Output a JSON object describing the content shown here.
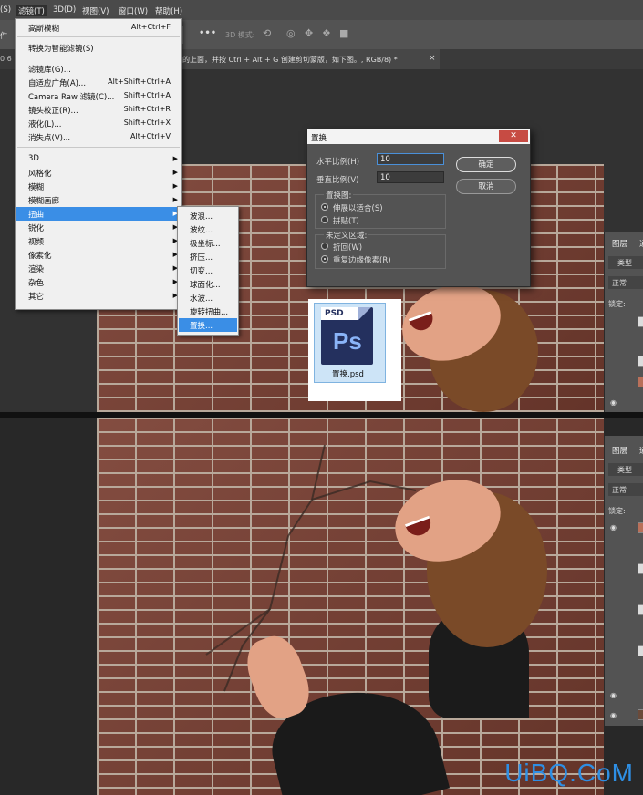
{
  "menubar": {
    "items": [
      "(S)",
      "滤镜(T)",
      "3D(D)",
      "视图(V)",
      "窗口(W)",
      "帮助(H)"
    ]
  },
  "optionsbar": {
    "left_label": "件",
    "more": "•••",
    "mode_label": "3D 模式:"
  },
  "doc_tab": {
    "text": "的上面，并按 Ctrl + Alt + G 创建剪切蒙版，如下图。, RGB/8) *",
    "close": "×",
    "left_fragment": "0 6"
  },
  "filter_menu": {
    "items": [
      {
        "label": "高斯模糊",
        "shortcut": "Alt+Ctrl+F"
      },
      {
        "label": "转换为智能滤镜(S)",
        "shortcut": ""
      },
      {
        "label": "滤镜库(G)...",
        "shortcut": ""
      },
      {
        "label": "自适应广角(A)...",
        "shortcut": "Alt+Shift+Ctrl+A"
      },
      {
        "label": "Camera Raw 滤镜(C)...",
        "shortcut": "Shift+Ctrl+A"
      },
      {
        "label": "镜头校正(R)...",
        "shortcut": "Shift+Ctrl+R"
      },
      {
        "label": "液化(L)...",
        "shortcut": "Shift+Ctrl+X"
      },
      {
        "label": "消失点(V)...",
        "shortcut": "Alt+Ctrl+V"
      },
      {
        "label": "3D",
        "shortcut": ""
      },
      {
        "label": "风格化",
        "shortcut": ""
      },
      {
        "label": "模糊",
        "shortcut": ""
      },
      {
        "label": "模糊画廊",
        "shortcut": ""
      },
      {
        "label": "扭曲",
        "shortcut": ""
      },
      {
        "label": "锐化",
        "shortcut": ""
      },
      {
        "label": "视频",
        "shortcut": ""
      },
      {
        "label": "像素化",
        "shortcut": ""
      },
      {
        "label": "渲染",
        "shortcut": ""
      },
      {
        "label": "杂色",
        "shortcut": ""
      },
      {
        "label": "其它",
        "shortcut": ""
      }
    ]
  },
  "distort_submenu": {
    "items": [
      "波浪...",
      "波纹...",
      "极坐标...",
      "挤压...",
      "切变...",
      "球面化...",
      "水波...",
      "旋转扭曲...",
      "置换..."
    ]
  },
  "displace_dialog": {
    "title": "置换",
    "close": "✕",
    "h_scale_label": "水平比例(H)",
    "h_scale_value": "10",
    "v_scale_label": "垂直比例(V)",
    "v_scale_value": "10",
    "ok": "确定",
    "cancel": "取消",
    "map_group": "置换图:",
    "stretch": "伸展以适合(S)",
    "tile": "拼贴(T)",
    "undefined_group": "未定义区域:",
    "wrap": "折回(W)",
    "repeat": "重复边缘像素(R)"
  },
  "psd_file": {
    "badge": "PSD",
    "logo": "Ps",
    "name": "置换.psd"
  },
  "layers_panel": {
    "tab": "图层",
    "tab2": "通",
    "search": "类型",
    "blend": "正常",
    "lock": "锁定:"
  },
  "watermark": "UiBQ.CoM"
}
